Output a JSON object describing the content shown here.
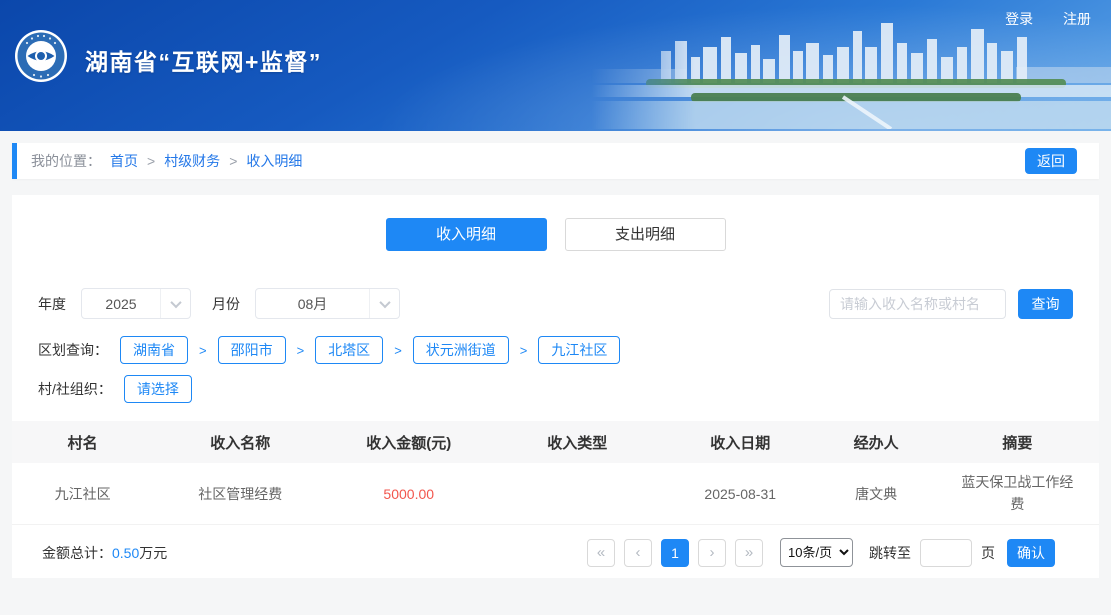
{
  "header": {
    "title": "湖南省“互联网+监督”",
    "login": "登录",
    "register": "注册"
  },
  "breadcrumb": {
    "label": "我的位置：",
    "items": [
      "首页",
      "村级财务",
      "收入明细"
    ],
    "separator": ">",
    "back_button": "返回"
  },
  "tabs": [
    {
      "label": "收入明细",
      "active": true
    },
    {
      "label": "支出明细",
      "active": false
    }
  ],
  "filters": {
    "year_label": "年度",
    "year_value": "2025",
    "month_label": "月份",
    "month_value": "08月",
    "search_placeholder": "请输入收入名称或村名",
    "search_button": "查询",
    "region_label": "区划查询：",
    "region_items": [
      "湖南省",
      "邵阳市",
      "北塔区",
      "状元洲街道",
      "九江社区"
    ],
    "region_separator": ">",
    "org_label": "村/社组织：",
    "org_button": "请选择"
  },
  "table": {
    "headers": [
      "村名",
      "收入名称",
      "收入金额(元)",
      "收入类型",
      "收入日期",
      "经办人",
      "摘要"
    ],
    "rows": [
      {
        "village": "九江社区",
        "income_name": "社区管理经费",
        "amount": "5000.00",
        "income_type": "",
        "date": "2025-08-31",
        "operator": "唐文典",
        "summary": "蓝天保卫战工作经费"
      }
    ]
  },
  "footer": {
    "total_label": "金额总计：",
    "total_value": "0.50",
    "total_unit": "万元",
    "pagination": {
      "first": "«",
      "prev": "‹",
      "pages": [
        "1"
      ],
      "next": "›",
      "last": "»",
      "page_size": "10条/页",
      "jump_label": "跳转至",
      "jump_unit": "页",
      "confirm_button": "确认"
    }
  },
  "colors": {
    "accent_blue": "#1e88f5",
    "link_blue": "#2478e8",
    "amount_red": "#f2564d",
    "header_gradient_start": "#0b47ab",
    "header_gradient_end": "#5fa5e7"
  }
}
